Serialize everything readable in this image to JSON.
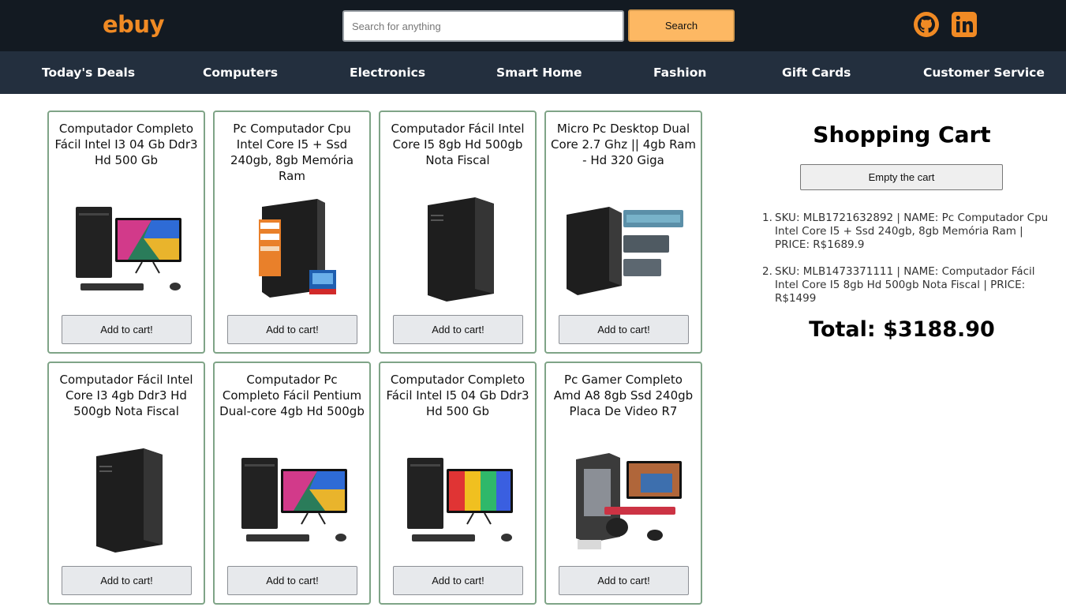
{
  "header": {
    "logo": "ebuy",
    "search": {
      "placeholder": "Search for anything",
      "value": ""
    },
    "search_button": "Search",
    "social": [
      "github-icon",
      "linkedin-icon"
    ],
    "accent": "#f08a24"
  },
  "nav": {
    "items": [
      "Today's Deals",
      "Computers",
      "Electronics",
      "Smart Home",
      "Fashion",
      "Gift Cards",
      "Customer Service"
    ]
  },
  "products": [
    {
      "title": "Computador Completo Fácil Intel I3 04 Gb Ddr3 Hd 500 Gb",
      "image": "desktop-with-monitor",
      "button": "Add to cart!"
    },
    {
      "title": "Pc Computador Cpu Intel Core I5 + Ssd 240gb, 8gb Memória Ram",
      "image": "tower-with-specs",
      "button": "Add to cart!"
    },
    {
      "title": "Computador Fácil Intel Core I5 8gb Hd 500gb Nota Fiscal",
      "image": "tower",
      "button": "Add to cart!"
    },
    {
      "title": "Micro Pc Desktop Dual Core 2.7 Ghz || 4gb Ram - Hd 320 Giga",
      "image": "mini-tower-with-specs",
      "button": "Add to cart!"
    },
    {
      "title": "Computador Fácil Intel Core I3 4gb Ddr3 Hd 500gb Nota Fiscal",
      "image": "tower",
      "button": "Add to cart!"
    },
    {
      "title": "Computador Pc Completo Fácil Pentium Dual-core 4gb Hd 500gb",
      "image": "desktop-with-monitor",
      "button": "Add to cart!"
    },
    {
      "title": "Computador Completo Fácil Intel I5 04 Gb Ddr3 Hd 500 Gb",
      "image": "desktop-with-monitor-rainbow",
      "button": "Add to cart!"
    },
    {
      "title": "Pc Gamer Completo Amd A8 8gb Ssd 240gb Placa De Video R7",
      "image": "gamer-setup",
      "button": "Add to cart!"
    }
  ],
  "cart": {
    "title": "Shopping Cart",
    "empty_button": "Empty the cart",
    "items": [
      {
        "num": "1.",
        "text": "SKU: MLB1721632892 | NAME: Pc Computador Cpu Intel Core I5 + Ssd 240gb, 8gb Memória Ram | PRICE: R$1689.9"
      },
      {
        "num": "2.",
        "text": "SKU: MLB1473371111 | NAME: Computador Fácil Intel Core I5 8gb Hd 500gb Nota Fiscal | PRICE: R$1499"
      }
    ],
    "total": "Total: $3188.90"
  }
}
